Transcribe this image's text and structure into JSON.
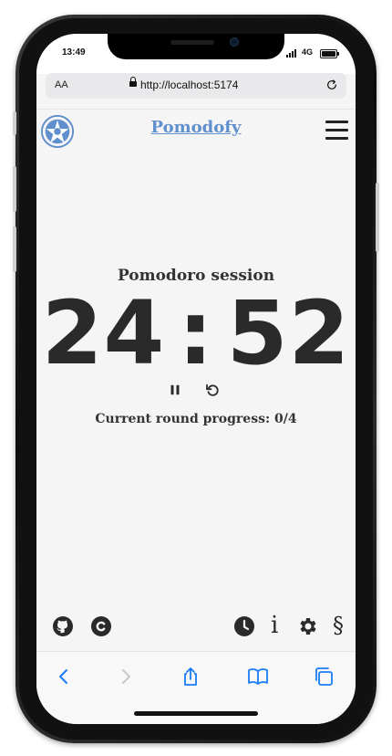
{
  "status_bar": {
    "time": "13:49",
    "network": "4G"
  },
  "browser": {
    "text_size_label": "AA",
    "url": "http://localhost:5174"
  },
  "header": {
    "app_title": "Pomodofy"
  },
  "timer": {
    "session_label": "Pomodoro session",
    "minutes": "24",
    "separator": ":",
    "seconds": "52",
    "round_progress": "Current round progress: 0/4"
  },
  "footer_icons": [
    "github-icon",
    "copyright-icon",
    "clock-icon",
    "info-icon",
    "gear-icon",
    "section-icon"
  ],
  "footer": {
    "info_glyph": "i",
    "section_glyph": "§"
  },
  "toolbar_icons": [
    "back-icon",
    "forward-icon",
    "share-icon",
    "bookmarks-icon",
    "tabs-icon"
  ],
  "colors": {
    "accent": "#5f8fcd",
    "toolbar_blue": "#1a7cf5",
    "text": "#2a2a2a",
    "background": "#f5f5f5"
  }
}
